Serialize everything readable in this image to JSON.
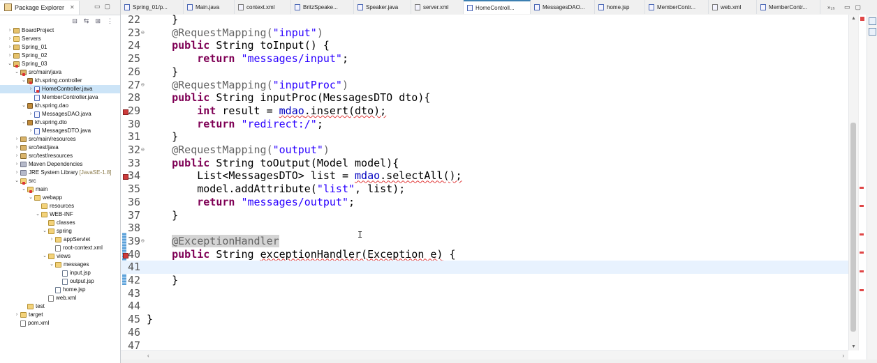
{
  "package_explorer": {
    "title": "Package Explorer",
    "tree": [
      {
        "label": "BoardProject",
        "depth": 0,
        "icon": "project-icon",
        "expanded": false
      },
      {
        "label": "Servers",
        "depth": 0,
        "icon": "folder-icon",
        "expanded": false
      },
      {
        "label": "Spring_01",
        "depth": 0,
        "icon": "project-icon",
        "expanded": false
      },
      {
        "label": "Spring_02",
        "depth": 0,
        "icon": "project-icon",
        "expanded": false
      },
      {
        "label": "Spring_03",
        "depth": 0,
        "icon": "project-icon",
        "expanded": true,
        "error": true
      },
      {
        "label": "src/main/java",
        "depth": 1,
        "icon": "source-folder-icon",
        "expanded": true,
        "error": true
      },
      {
        "label": "kh.spring.controller",
        "depth": 2,
        "icon": "package-icon",
        "expanded": true,
        "error": true
      },
      {
        "label": "HomeController.java",
        "depth": 3,
        "icon": "java-file-icon",
        "expanded": false,
        "error": true,
        "selected": true
      },
      {
        "label": "MemberController.java",
        "depth": 3,
        "icon": "java-file-icon",
        "leaf": true
      },
      {
        "label": "kh.spring.dao",
        "depth": 2,
        "icon": "package-icon",
        "expanded": true
      },
      {
        "label": "MessagesDAO.java",
        "depth": 3,
        "icon": "java-file-icon",
        "expanded": false
      },
      {
        "label": "kh.spring.dto",
        "depth": 2,
        "icon": "package-icon",
        "expanded": true
      },
      {
        "label": "MessagesDTO.java",
        "depth": 3,
        "icon": "java-file-icon",
        "expanded": false
      },
      {
        "label": "src/main/resources",
        "depth": 1,
        "icon": "source-folder-icon",
        "expanded": false
      },
      {
        "label": "src/test/java",
        "depth": 1,
        "icon": "source-folder-icon",
        "expanded": false
      },
      {
        "label": "src/test/resources",
        "depth": 1,
        "icon": "source-folder-icon",
        "expanded": false
      },
      {
        "label": "Maven Dependencies",
        "depth": 1,
        "icon": "library-icon",
        "expanded": false
      },
      {
        "label": "JRE System Library",
        "suffix": "[JavaSE-1.8]",
        "depth": 1,
        "icon": "library-icon",
        "expanded": false
      },
      {
        "label": "src",
        "depth": 1,
        "icon": "folder-icon",
        "expanded": true,
        "error": true
      },
      {
        "label": "main",
        "depth": 2,
        "icon": "folder-icon",
        "expanded": true,
        "error": true
      },
      {
        "label": "webapp",
        "depth": 3,
        "icon": "folder-icon",
        "expanded": true
      },
      {
        "label": "resources",
        "depth": 4,
        "icon": "folder-icon",
        "leaf": true
      },
      {
        "label": "WEB-INF",
        "depth": 4,
        "icon": "folder-icon",
        "expanded": true
      },
      {
        "label": "classes",
        "depth": 5,
        "icon": "folder-icon",
        "leaf": true
      },
      {
        "label": "spring",
        "depth": 5,
        "icon": "folder-icon",
        "expanded": true
      },
      {
        "label": "appServlet",
        "depth": 6,
        "icon": "folder-icon",
        "expanded": false
      },
      {
        "label": "root-context.xml",
        "depth": 6,
        "icon": "xml-file-icon",
        "leaf": true
      },
      {
        "label": "views",
        "depth": 5,
        "icon": "folder-icon",
        "expanded": true
      },
      {
        "label": "messages",
        "depth": 6,
        "icon": "folder-icon",
        "expanded": true
      },
      {
        "label": "input.jsp",
        "depth": 7,
        "icon": "jsp-file-icon",
        "leaf": true
      },
      {
        "label": "output.jsp",
        "depth": 7,
        "icon": "jsp-file-icon",
        "leaf": true
      },
      {
        "label": "home.jsp",
        "depth": 6,
        "icon": "jsp-file-icon",
        "leaf": true
      },
      {
        "label": "web.xml",
        "depth": 5,
        "icon": "xml-file-icon",
        "leaf": true
      },
      {
        "label": "test",
        "depth": 2,
        "icon": "folder-icon",
        "leaf": true
      },
      {
        "label": "target",
        "depth": 1,
        "icon": "folder-icon",
        "expanded": false
      },
      {
        "label": "pom.xml",
        "depth": 1,
        "icon": "xml-file-icon",
        "leaf": true
      }
    ]
  },
  "editor_tabs": [
    {
      "label": "Spring_01/p...",
      "kind": "jsp",
      "width": 84
    },
    {
      "label": "Main.java",
      "kind": "java",
      "width": 67
    },
    {
      "label": "context.xml",
      "kind": "xml",
      "width": 75
    },
    {
      "label": "BritzSpeake...",
      "kind": "java",
      "width": 84
    },
    {
      "label": "Speaker.java",
      "kind": "java",
      "width": 76
    },
    {
      "label": "server.xml",
      "kind": "xml",
      "width": 69
    },
    {
      "label": "HomeControll...",
      "kind": "java",
      "width": 90,
      "active": true
    },
    {
      "label": "MessagesDAO...",
      "kind": "java",
      "width": 86
    },
    {
      "label": "home.jsp",
      "kind": "jsp",
      "width": 66
    },
    {
      "label": "MemberContr...",
      "kind": "java",
      "width": 85
    },
    {
      "label": "web.xml",
      "kind": "xml",
      "width": 63
    },
    {
      "label": "MemberContr...",
      "kind": "java",
      "width": 85
    }
  ],
  "tab_overflow": "»₂₅",
  "editor": {
    "lines": [
      {
        "n": "22",
        "tokens": [
          {
            "t": "    }"
          }
        ]
      },
      {
        "n": "23",
        "fold": true,
        "tokens": [
          {
            "t": "    "
          },
          {
            "t": "@RequestMapping(",
            "c": "an"
          },
          {
            "t": "\"input\"",
            "c": "st"
          },
          {
            "t": ")",
            "c": "an"
          }
        ]
      },
      {
        "n": "24",
        "tokens": [
          {
            "t": "    "
          },
          {
            "t": "public",
            "c": "kw"
          },
          {
            "t": " String toInput() {"
          }
        ]
      },
      {
        "n": "25",
        "tokens": [
          {
            "t": "        "
          },
          {
            "t": "return",
            "c": "kw"
          },
          {
            "t": " "
          },
          {
            "t": "\"messages/input\"",
            "c": "st"
          },
          {
            "t": ";"
          }
        ]
      },
      {
        "n": "26",
        "tokens": [
          {
            "t": "    }"
          }
        ]
      },
      {
        "n": "27",
        "fold": true,
        "tokens": [
          {
            "t": "    "
          },
          {
            "t": "@RequestMapping(",
            "c": "an"
          },
          {
            "t": "\"inputProc\"",
            "c": "st"
          },
          {
            "t": ")",
            "c": "an"
          }
        ]
      },
      {
        "n": "28",
        "tokens": [
          {
            "t": "    "
          },
          {
            "t": "public",
            "c": "kw"
          },
          {
            "t": " String inputProc(MessagesDTO dto){"
          }
        ]
      },
      {
        "n": "29",
        "marker": true,
        "tokens": [
          {
            "t": "        "
          },
          {
            "t": "int",
            "c": "kw"
          },
          {
            "t": " result = "
          },
          {
            "t": "mdao",
            "c": "fd sq"
          },
          {
            "t": ".insert(dto);",
            "c": "sq"
          }
        ]
      },
      {
        "n": "30",
        "tokens": [
          {
            "t": "        "
          },
          {
            "t": "return",
            "c": "kw"
          },
          {
            "t": " "
          },
          {
            "t": "\"redirect:/\"",
            "c": "st"
          },
          {
            "t": ";"
          }
        ]
      },
      {
        "n": "31",
        "tokens": [
          {
            "t": "    }"
          }
        ]
      },
      {
        "n": "32",
        "fold": true,
        "tokens": [
          {
            "t": "    "
          },
          {
            "t": "@RequestMapping(",
            "c": "an"
          },
          {
            "t": "\"output\"",
            "c": "st"
          },
          {
            "t": ")",
            "c": "an"
          }
        ]
      },
      {
        "n": "33",
        "tokens": [
          {
            "t": "    "
          },
          {
            "t": "public",
            "c": "kw"
          },
          {
            "t": " String toOutput(Model model){"
          }
        ]
      },
      {
        "n": "34",
        "marker": true,
        "tokens": [
          {
            "t": "        List<MessagesDTO> list = "
          },
          {
            "t": "mdao",
            "c": "fd sq"
          },
          {
            "t": ".selectAll();",
            "c": "sq"
          }
        ]
      },
      {
        "n": "35",
        "tokens": [
          {
            "t": "        model.addAttribute("
          },
          {
            "t": "\"list\"",
            "c": "st"
          },
          {
            "t": ", list);"
          }
        ]
      },
      {
        "n": "36",
        "tokens": [
          {
            "t": "        "
          },
          {
            "t": "return",
            "c": "kw"
          },
          {
            "t": " "
          },
          {
            "t": "\"messages/output\"",
            "c": "st"
          },
          {
            "t": ";"
          }
        ]
      },
      {
        "n": "37",
        "tokens": [
          {
            "t": "    }"
          }
        ]
      },
      {
        "n": "38",
        "tokens": [
          {
            "t": ""
          }
        ]
      },
      {
        "n": "39",
        "fold": true,
        "tokens": [
          {
            "t": "    "
          },
          {
            "t": "@ExceptionHandler",
            "c": "an hl"
          }
        ]
      },
      {
        "n": "40",
        "marker": true,
        "tokens": [
          {
            "t": "    "
          },
          {
            "t": "public",
            "c": "kw"
          },
          {
            "t": " String "
          },
          {
            "t": "exceptionHandler(Exception e)",
            "c": "sq"
          },
          {
            "t": " {"
          }
        ]
      },
      {
        "n": "41",
        "current": true,
        "tokens": [
          {
            "t": ""
          }
        ]
      },
      {
        "n": "42",
        "tokens": [
          {
            "t": "    }"
          }
        ]
      },
      {
        "n": "43",
        "tokens": [
          {
            "t": ""
          }
        ]
      },
      {
        "n": "44",
        "tokens": [
          {
            "t": ""
          }
        ]
      },
      {
        "n": "45",
        "tokens": [
          {
            "t": "}"
          }
        ]
      },
      {
        "n": "46",
        "tokens": [
          {
            "t": ""
          }
        ]
      },
      {
        "n": "47",
        "tokens": [
          {
            "t": ""
          }
        ]
      }
    ]
  },
  "overview_markers": [
    0.512,
    0.567,
    0.652,
    0.705,
    0.762,
    0.818
  ]
}
